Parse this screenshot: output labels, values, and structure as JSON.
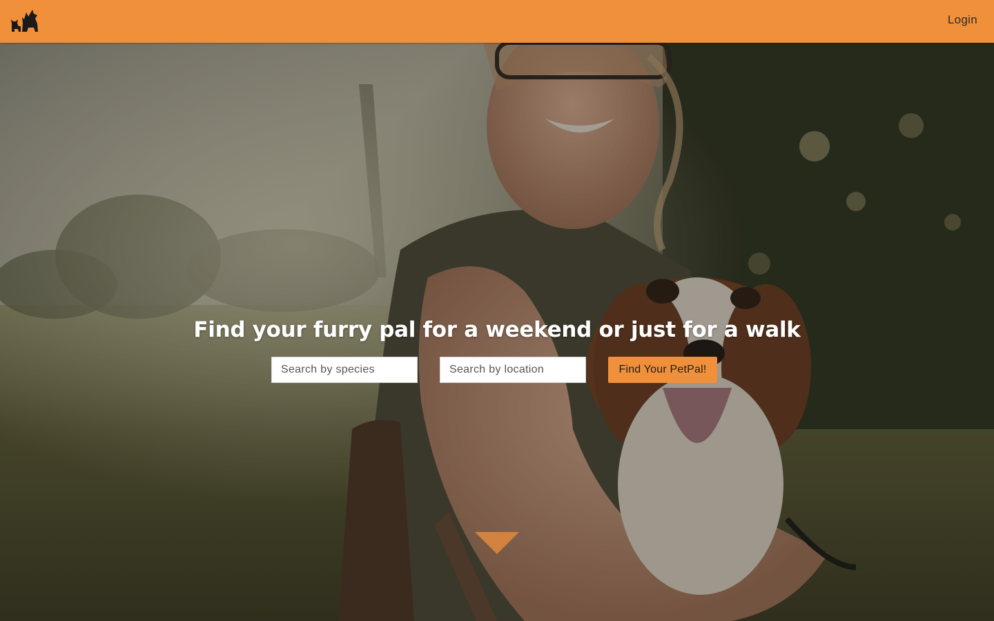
{
  "nav": {
    "logo_icon": "pets-logo-icon",
    "login_label": "Login",
    "bar_color": "#f0903a"
  },
  "hero": {
    "background": "photo of smiling woman holding a cavalier king charles spaniel outdoors",
    "headline": "Find your furry pal for a weekend or just for a walk",
    "species_placeholder": "Search by species",
    "location_placeholder": "Search by location",
    "search_button_label": "Find Your PetPal!",
    "accent_color": "#f0903a",
    "scroll_icon": "triangle-down-icon"
  }
}
